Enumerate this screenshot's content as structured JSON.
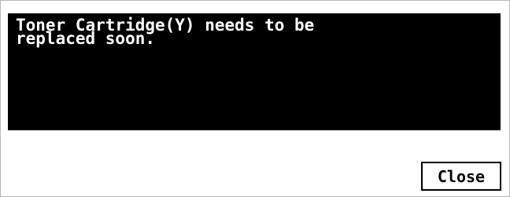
{
  "dialog": {
    "message": "Toner Cartridge(Y) needs to be\nreplaced soon.",
    "close_label": "Close"
  },
  "colors": {
    "panel_background": "#000000",
    "panel_text": "#ffffff",
    "dialog_background": "#ffffff",
    "button_border": "#000000"
  }
}
